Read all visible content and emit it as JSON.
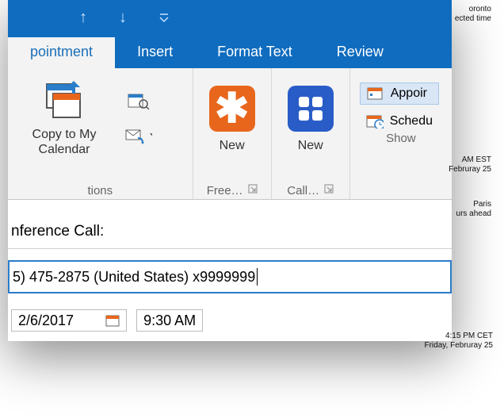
{
  "titlebar": {
    "arrow_up": "↑",
    "arrow_down": "↓"
  },
  "tabs": {
    "appointment": "pointment",
    "insert": "Insert",
    "format_text": "Format Text",
    "review": "Review"
  },
  "ribbon": {
    "copy_to_my_calendar": "Copy to My Calendar",
    "group1_label": "tions",
    "new1": "New",
    "new2": "New",
    "group2_label": "Free…",
    "group3_label": "Call…",
    "show_appointment": "Appoir",
    "show_schedule": "Schedu",
    "group4_label": "Show"
  },
  "content": {
    "subject_label": "nference Call:",
    "location_value": "5) 475-2875 (United States) x9999999",
    "date": "2/6/2017",
    "time": "9:30 AM"
  },
  "annotations": {
    "a1_l1": "oronto",
    "a1_l2": "ected time",
    "a2_l1": "AM EST",
    "a2_l2": "Februray 25",
    "a3_l1": "Paris",
    "a3_l2": "urs ahead",
    "a4_l1": "4:15 PM CET",
    "a4_l2": "Friday, Februray 25"
  }
}
